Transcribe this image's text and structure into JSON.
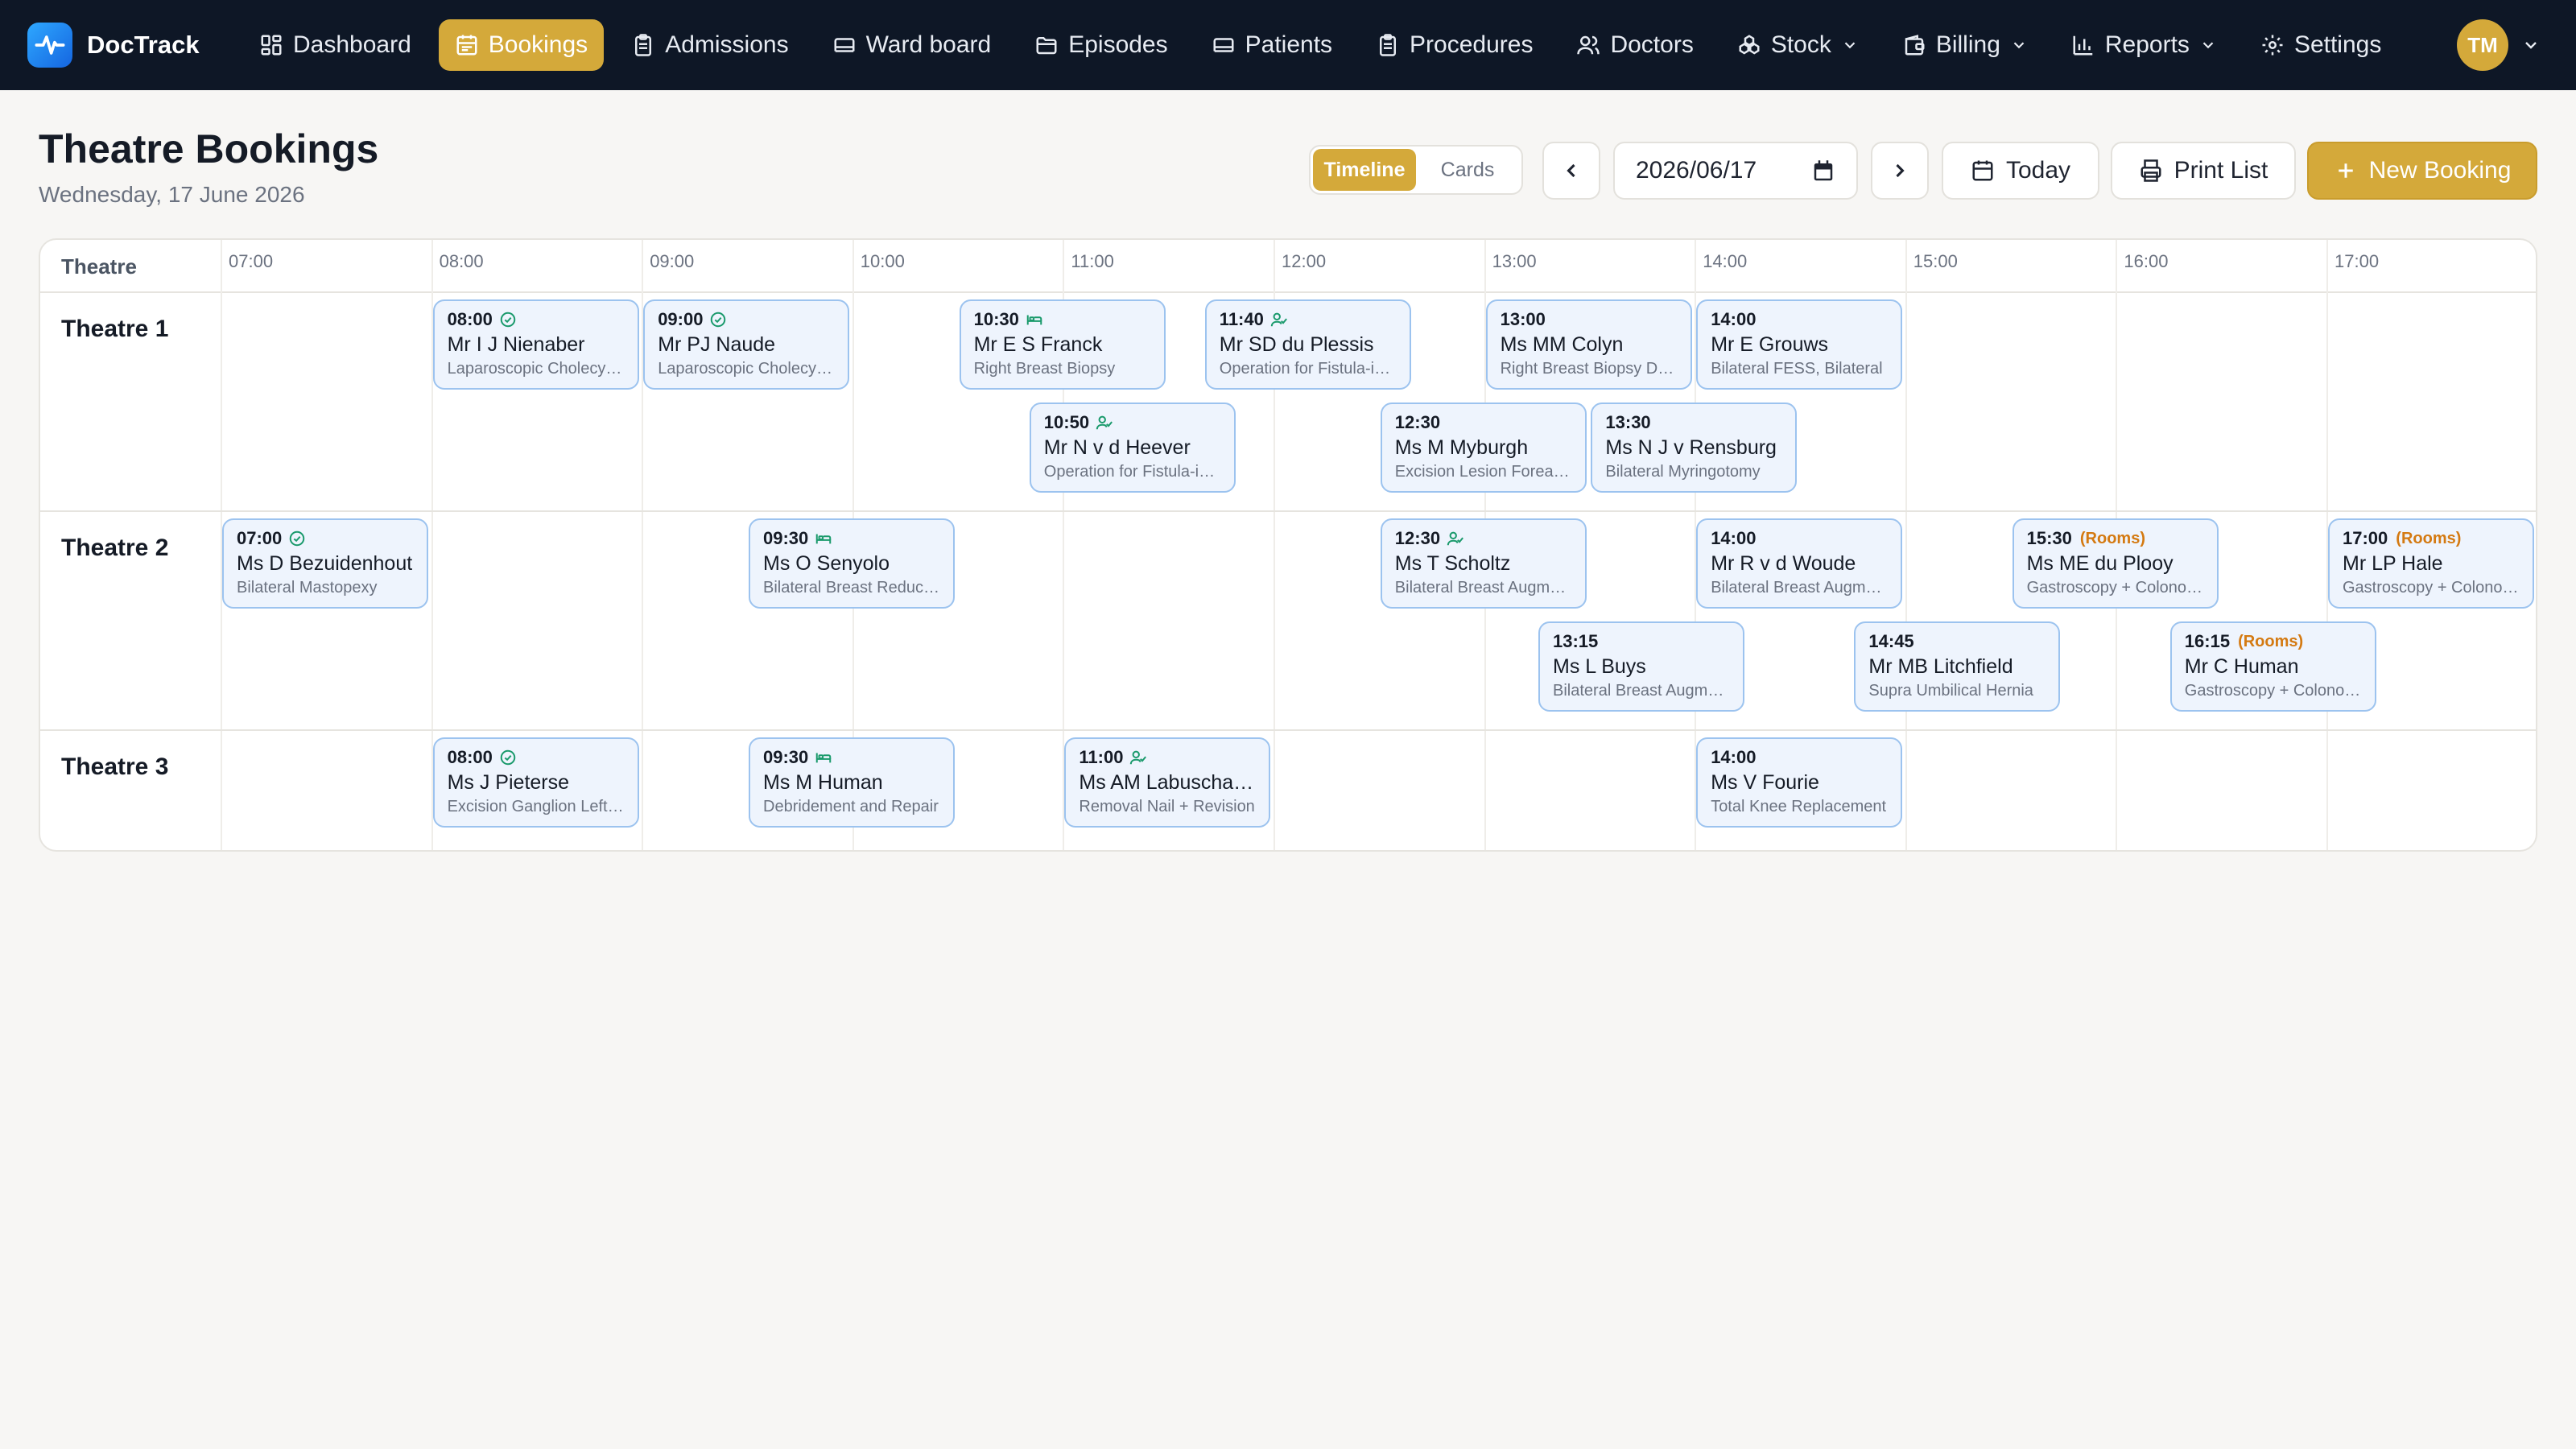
{
  "brand": {
    "name": "DocTrack"
  },
  "nav": {
    "items": [
      {
        "label": "Dashboard",
        "icon": "dashboard-icon"
      },
      {
        "label": "Bookings",
        "icon": "calendar-icon",
        "active": true
      },
      {
        "label": "Admissions",
        "icon": "clipboard-icon"
      },
      {
        "label": "Ward board",
        "icon": "bed-icon"
      },
      {
        "label": "Episodes",
        "icon": "folder-icon"
      },
      {
        "label": "Patients",
        "icon": "bed-icon"
      },
      {
        "label": "Procedures",
        "icon": "clipboard-icon"
      },
      {
        "label": "Doctors",
        "icon": "users-icon"
      },
      {
        "label": "Stock",
        "icon": "boxes-icon",
        "dropdown": true
      },
      {
        "label": "Billing",
        "icon": "wallet-icon",
        "dropdown": true
      },
      {
        "label": "Reports",
        "icon": "bar-chart-icon",
        "dropdown": true
      },
      {
        "label": "Settings",
        "icon": "gear-icon"
      }
    ],
    "user_initials": "TM"
  },
  "header": {
    "title": "Theatre Bookings",
    "date_long": "Wednesday, 17 June 2026",
    "view_toggle": {
      "timeline": "Timeline",
      "cards": "Cards",
      "active": "timeline"
    },
    "date_value": "2026/06/17",
    "today_label": "Today",
    "print_label": "Print List",
    "new_booking_label": "New Booking"
  },
  "timeline": {
    "theatre_column_label": "Theatre",
    "hours": [
      "07:00",
      "08:00",
      "09:00",
      "10:00",
      "11:00",
      "12:00",
      "13:00",
      "14:00",
      "15:00",
      "16:00",
      "17:00"
    ],
    "theatres": [
      {
        "name": "Theatre 1",
        "bookings": [
          {
            "time": "08:00",
            "status": "confirmed",
            "patient": "Mr I J Nienaber",
            "procedure": "Laparoscopic Cholecystectomy",
            "lane": 0
          },
          {
            "time": "09:00",
            "status": "confirmed",
            "patient": "Mr PJ Naude",
            "procedure": "Laparoscopic Cholecystectomy",
            "lane": 0
          },
          {
            "time": "10:30",
            "status": "admitted",
            "patient": "Mr E S Franck",
            "procedure": "Right Breast Biopsy",
            "lane": 0
          },
          {
            "time": "10:50",
            "status": "assigned",
            "patient": "Mr N v d Heever",
            "procedure": "Operation for Fistula-in-ano",
            "lane": 1
          },
          {
            "time": "11:40",
            "status": "assigned",
            "patient": "Mr SD du Plessis",
            "procedure": "Operation for Fistula-in-ano",
            "lane": 0
          },
          {
            "time": "12:30",
            "status": "",
            "patient": "Ms M Myburgh",
            "procedure": "Excision Lesion Forearm",
            "lane": 1
          },
          {
            "time": "13:00",
            "status": "",
            "patient": "Ms MM Colyn",
            "procedure": "Right Breast Biopsy Drain",
            "lane": 0
          },
          {
            "time": "13:30",
            "status": "",
            "patient": "Ms N J v Rensburg",
            "procedure": "Bilateral Myringotomy",
            "lane": 1
          },
          {
            "time": "14:00",
            "status": "",
            "patient": "Mr E Grouws",
            "procedure": "Bilateral FESS, Bilateral",
            "lane": 0
          }
        ]
      },
      {
        "name": "Theatre 2",
        "bookings": [
          {
            "time": "07:00",
            "status": "confirmed",
            "patient": "Ms D Bezuidenhout",
            "procedure": "Bilateral Mastopexy",
            "lane": 0
          },
          {
            "time": "09:30",
            "status": "admitted",
            "patient": "Ms O Senyolo",
            "procedure": "Bilateral Breast Reduction",
            "lane": 0
          },
          {
            "time": "12:30",
            "status": "assigned",
            "patient": "Ms T Scholtz",
            "procedure": "Bilateral Breast Augmentation",
            "lane": 0
          },
          {
            "time": "13:15",
            "status": "",
            "patient": "Ms L Buys",
            "procedure": "Bilateral Breast Augmentation",
            "lane": 1
          },
          {
            "time": "14:00",
            "status": "",
            "patient": "Mr R v d Woude",
            "procedure": "Bilateral Breast Augmentation",
            "lane": 0
          },
          {
            "time": "14:45",
            "status": "",
            "patient": "Mr MB Litchfield",
            "procedure": "Supra Umbilical Hernia",
            "lane": 1
          },
          {
            "time": "15:30",
            "status": "",
            "tag": "(Rooms)",
            "patient": "Ms ME du Plooy",
            "procedure": "Gastroscopy + Colonoscopy",
            "lane": 0
          },
          {
            "time": "16:15",
            "status": "",
            "tag": "(Rooms)",
            "patient": "Mr C Human",
            "procedure": "Gastroscopy + Colonoscopy",
            "lane": 1
          },
          {
            "time": "17:00",
            "status": "",
            "tag": "(Rooms)",
            "patient": "Mr LP Hale",
            "procedure": "Gastroscopy + Colonoscopy",
            "lane": 0
          }
        ]
      },
      {
        "name": "Theatre 3",
        "bookings": [
          {
            "time": "08:00",
            "status": "confirmed",
            "patient": "Ms J Pieterse",
            "procedure": "Excision Ganglion Left Wrist",
            "lane": 0
          },
          {
            "time": "09:30",
            "status": "admitted",
            "patient": "Ms M Human",
            "procedure": "Debridement and Repair",
            "lane": 0
          },
          {
            "time": "11:00",
            "status": "assigned",
            "patient": "Ms AM Labuschagne",
            "procedure": "Removal Nail + Revision",
            "lane": 0
          },
          {
            "time": "14:00",
            "status": "",
            "patient": "Ms V Fourie",
            "procedure": "Total Knee Replacement",
            "lane": 0
          }
        ]
      }
    ]
  },
  "colors": {
    "nav_bg": "#0e1726",
    "accent": "#d4a93a",
    "card_bg": "#eef4fd",
    "card_border": "#9cc3ef",
    "status_green": "#1a9a6c",
    "rooms_orange": "#d47a12"
  }
}
